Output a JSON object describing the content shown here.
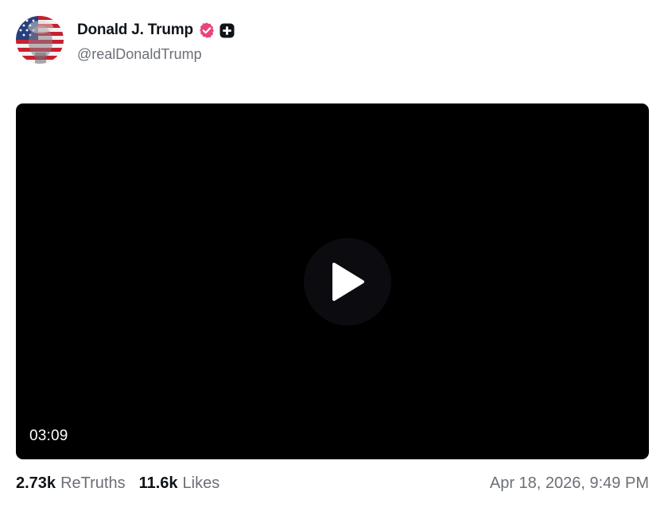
{
  "post": {
    "author": {
      "display_name": "Donald J. Trump",
      "handle": "@realDonaldTrump",
      "verified": true,
      "verified_color": "#e8457a",
      "avatar_icon": "flag-face-avatar"
    },
    "media": {
      "type": "video",
      "duration": "03:09",
      "background": "#000000"
    },
    "stats": {
      "retruths_count": "2.73k",
      "retruths_label": "ReTruths",
      "likes_count": "11.6k",
      "likes_label": "Likes"
    },
    "timestamp": "Apr 18, 2026, 9:49 PM"
  }
}
